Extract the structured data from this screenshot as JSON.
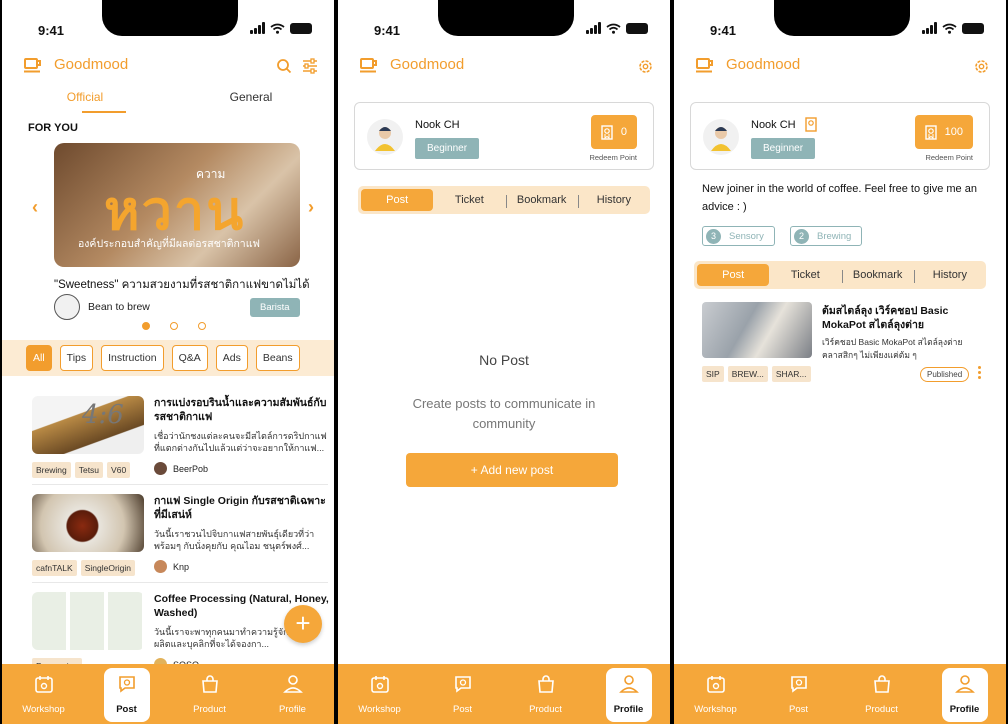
{
  "colors": {
    "accent": "#f5a73a",
    "teal": "#8fb4b6",
    "chipbg": "#fcebd3"
  },
  "status": {
    "time": "9:41"
  },
  "brand": {
    "name": "Goodmood"
  },
  "feed_screen": {
    "tabs": [
      "Official",
      "General"
    ],
    "section": "FOR YOU",
    "hero": {
      "big": "หวาน",
      "small": "ความ",
      "sub": "องค์ประกอบสำคัญที่มีผลต่อรสชาติกาแฟ"
    },
    "caption": "\"Sweetness\" ความสวยงามที่รสชาติกาแฟขาดไม่ได้",
    "author": "Bean to brew",
    "badge": "Barista",
    "chips": [
      "All",
      "Tips",
      "Instruction",
      "Q&A",
      "Ads",
      "Beans"
    ],
    "items": [
      {
        "title": "การแบ่งรอบรินน้ำและความสัมพันธ์กับรสชาติกาแฟ",
        "desc": "เชื่อว่านักชงแต่ละคนจะมีสไตล์การดริปกาแฟที่แตกต่างกันไปแล้วแต่ว่าจะอยากให้กาแฟ...",
        "tags": [
          "Brewing",
          "Tetsu",
          "V60"
        ],
        "author": "BeerPob",
        "thumb_text": "4:6"
      },
      {
        "title": "กาแฟ Single Origin กับรสชาติเฉพาะที่มีเสน่ห์",
        "desc": "วันนี้เราชวนไปจิบกาแฟสายพันธุ์เดียวที่ว่าพร้อมๆ กับนั่งคุยกับ คุณไอม ชนุตร์พงศ์...",
        "tags": [
          "cafnTALK",
          "SingleOrigin"
        ],
        "author": "Knp"
      },
      {
        "title": "Coffee Processing (Natural, Honey, Washed)",
        "desc": "วันนี้เราจะพาทุกคนมาทำความรู้จักวิธีการผลิตและบุคลิกที่จะได้จองกา...",
        "tags": [
          "Processing"
        ],
        "author": "SOSO"
      }
    ]
  },
  "profile": {
    "name": "Nook CH",
    "level": "Beginner",
    "redeem_label": "Redeem Point",
    "points_empty": "0",
    "points_full": "100",
    "tabs": [
      "Post",
      "Ticket",
      "Bookmark",
      "History"
    ],
    "empty": {
      "title": "No Post",
      "message": "Create posts to communicate in community",
      "button": "+ Add new post"
    },
    "bio": "New joiner in the world of coffee. Feel free to give me an advice : )",
    "skills": [
      {
        "n": "3",
        "label": "Sensory"
      },
      {
        "n": "2",
        "label": "Brewing"
      }
    ],
    "post": {
      "title": "ต้มสไตล์ลุง เวิร์คชอป Basic MokaPot สไตล์ลุงต่าย",
      "desc": "เวิร์คชอป Basic MokaPot สไตล์ลุงต่าย คลาสสิกๆ ไม่เพียงแค่ต้ม ๆ",
      "tags": [
        "SIP",
        "BREW...",
        "SHAR..."
      ],
      "status": "Published"
    }
  },
  "nav": [
    "Workshop",
    "Post",
    "Product",
    "Profile"
  ]
}
